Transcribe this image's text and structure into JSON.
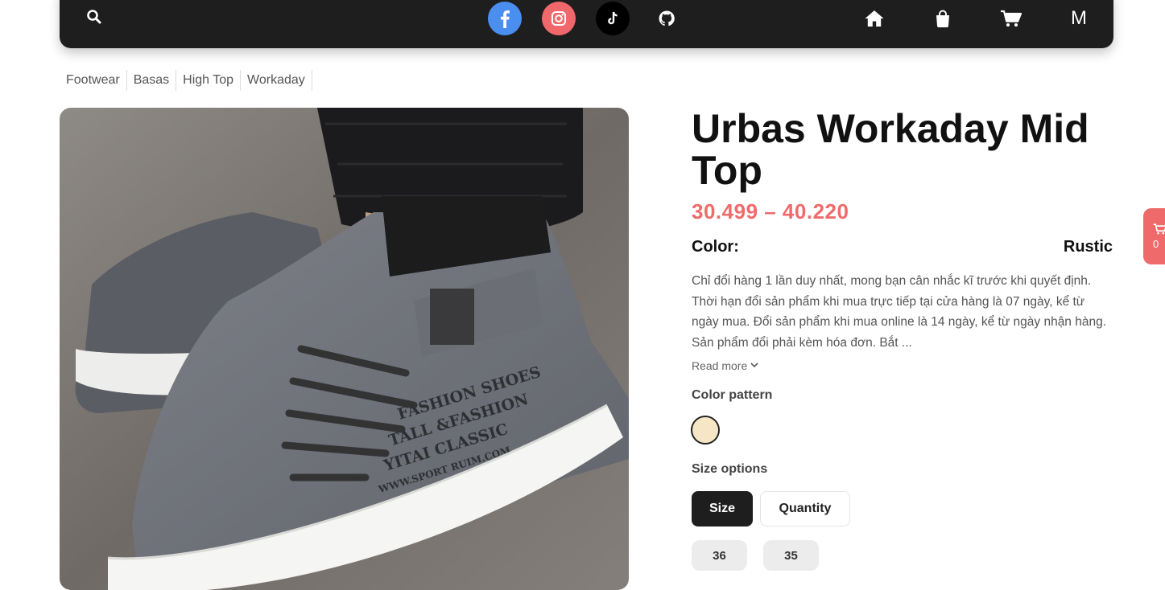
{
  "nav": {
    "icons": [
      "search-icon",
      "facebook-icon",
      "instagram-icon",
      "tiktok-icon",
      "github-icon",
      "home-icon",
      "shopping-bag-icon",
      "cart-icon"
    ],
    "user_initial": "M",
    "colors": {
      "bar": "#1e1e1e",
      "facebook": "#4a8ff0",
      "instagram": "#f0686c",
      "tiktok": "#000000"
    }
  },
  "breadcrumb": [
    "Footwear",
    "Basas",
    "High Top",
    "Workaday"
  ],
  "product": {
    "title": "Urbas Workaday Mid Top",
    "price": "30.499 – 40.220",
    "color_label": "Color:",
    "color_value": "Rustic",
    "description": "Chỉ đổi hàng 1 lần duy nhất, mong bạn cân nhắc kĩ trước khi quyết định. Thời hạn đổi sản phẩm khi mua trực tiếp tại cửa hàng là 07 ngày, kể từ ngày mua. Đổi sản phẩm khi mua online là 14 ngày, kể từ ngày nhận hàng. Sản phẩm đổi phải kèm hóa đơn. Bắt ...",
    "read_more": "Read more",
    "color_pattern_label": "Color pattern",
    "swatch_color": "#f6e6c6",
    "size_options_label": "Size options",
    "tabs": {
      "size": "Size",
      "quantity": "Quantity"
    },
    "sizes": [
      "36",
      "35"
    ],
    "price_color": "#ef6b6b",
    "image_print": [
      "FASHION SHOES",
      "TALL &FASHION",
      "YITAI CLASSIC",
      "WWW.SPORT RUIM.COM"
    ]
  },
  "floating_cart": {
    "count": "0"
  }
}
